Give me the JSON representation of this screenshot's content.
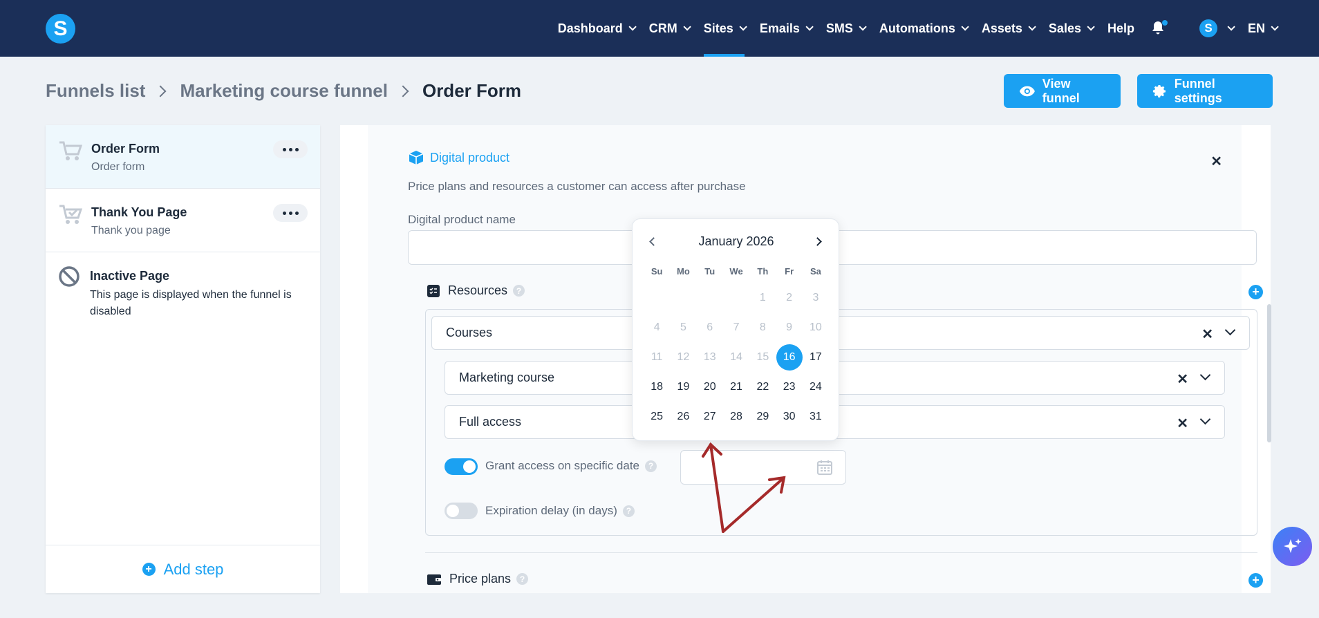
{
  "nav": {
    "logo_letter": "S",
    "items": [
      {
        "label": "Dashboard",
        "chevron": true
      },
      {
        "label": "CRM",
        "chevron": true
      },
      {
        "label": "Sites",
        "chevron": true,
        "active": true
      },
      {
        "label": "Emails",
        "chevron": true
      },
      {
        "label": "SMS",
        "chevron": true
      },
      {
        "label": "Automations",
        "chevron": true
      },
      {
        "label": "Assets",
        "chevron": true
      },
      {
        "label": "Sales",
        "chevron": true
      },
      {
        "label": "Help",
        "chevron": false
      }
    ],
    "avatar_letter": "S",
    "language": "EN"
  },
  "breadcrumb": {
    "funnels_list": "Funnels list",
    "funnel_name": "Marketing course funnel",
    "current": "Order Form"
  },
  "header_buttons": {
    "view_funnel": "View funnel",
    "funnel_settings": "Funnel settings"
  },
  "steps": [
    {
      "title": "Order Form",
      "subtitle": "Order form",
      "active": true
    },
    {
      "title": "Thank You Page",
      "subtitle": "Thank you page",
      "active": false
    }
  ],
  "inactive_step": {
    "title": "Inactive Page",
    "description": "This page is displayed when the funnel is disabled"
  },
  "add_step_label": "Add step",
  "digital_product": {
    "title": "Digital product",
    "description": "Price plans and resources a customer can access after purchase",
    "name_label": "Digital product name",
    "name_value": ""
  },
  "resources": {
    "title": "Resources",
    "help": "?",
    "type_select": "Courses",
    "course_select": "Marketing course",
    "access_select": "Full access",
    "grant_access_label": "Grant access on specific date",
    "grant_access_on": true,
    "expiration_label": "Expiration delay (in days)",
    "expiration_on": false
  },
  "price_plans": {
    "title": "Price plans",
    "help": "?"
  },
  "calendar": {
    "month_label": "January 2026",
    "weekdays": [
      "Su",
      "Mo",
      "Tu",
      "We",
      "Th",
      "Fr",
      "Sa"
    ],
    "leading_blanks": 4,
    "days_in_month": 31,
    "selected_day": 16,
    "first_enabled_day": 16
  },
  "colors": {
    "nav_bg": "#1b2f58",
    "accent": "#1ba1f2",
    "annotation_arrow": "#a52a2a"
  }
}
